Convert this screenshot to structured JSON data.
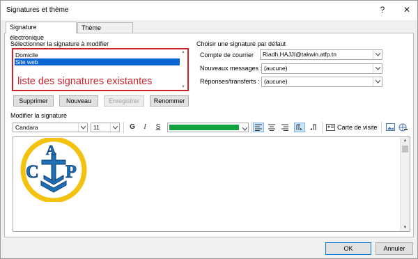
{
  "window": {
    "title": "Signatures et thème",
    "help_label": "?",
    "close_label": "✕"
  },
  "tabs": [
    {
      "label": "Signature électronique",
      "active": true
    },
    {
      "label": "Thème personnel",
      "active": false
    }
  ],
  "select_section": {
    "label": "Sélectionner la signature à modifier",
    "items": [
      "Domicile",
      "Site web"
    ],
    "selected_index": 1,
    "annotation": "liste des signatures existantes",
    "annotation_color": "#d11f2a"
  },
  "list_buttons": {
    "delete": "Supprimer",
    "new": "Nouveau",
    "save": "Enregistrer",
    "rename": "Renommer"
  },
  "default_section": {
    "label": "Choisir une signature par défaut",
    "account_label": "Compte de courrier",
    "account_value": "Riadh.HAJJI@takwin.atfp.tn",
    "new_messages_label": "Nouveaux messages :",
    "new_messages_value": "(aucune)",
    "replies_label": "Réponses/transferts :",
    "replies_value": "(aucune)"
  },
  "edit_section": {
    "label": "Modifier la signature",
    "font_name": "Candara",
    "font_size": "11",
    "bold_label": "G",
    "italic_label": "I",
    "underline_label": "S",
    "text_color": "#12a140",
    "business_card_label": "Carte de visite"
  },
  "logo": {
    "letters": [
      "C",
      "A",
      "P"
    ],
    "ring_color": "#f4c20d",
    "emblem_color": "#1d6fb8"
  },
  "footer": {
    "ok": "OK",
    "cancel": "Annuler"
  }
}
